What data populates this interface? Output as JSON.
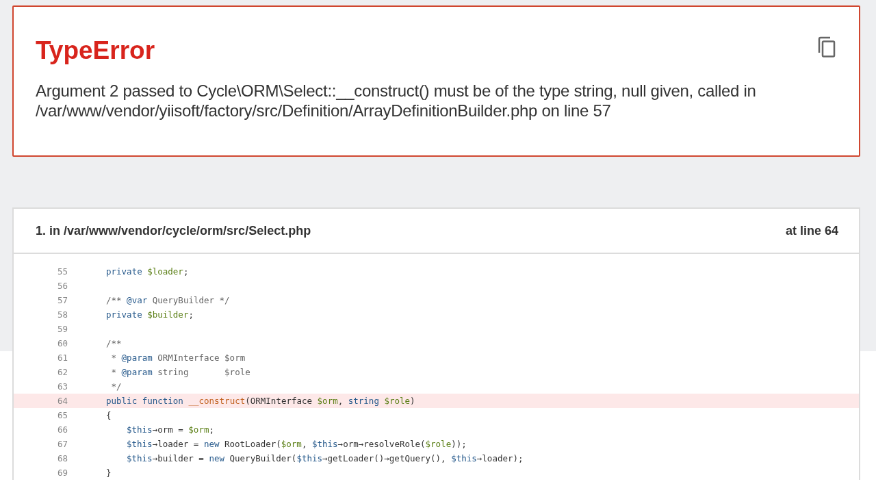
{
  "error": {
    "type": "TypeError",
    "message": "Argument 2 passed to Cycle\\ORM\\Select::__construct() must be of the type string, null given, called in /var/www/vendor/yiisoft/factory/src/Definition/ArrayDefinitionBuilder.php on line 57"
  },
  "frame": {
    "title": "1. in /var/www/vendor/cycle/orm/src/Select.php",
    "line_label": "at line 64",
    "lines": [
      {
        "number": "55",
        "selected": false,
        "tokens": [
          {
            "kind": "keyword",
            "text": "private "
          },
          {
            "kind": "variable",
            "text": "$loader"
          },
          {
            "kind": "plain",
            "text": ";"
          }
        ]
      },
      {
        "number": "56",
        "selected": false
      },
      {
        "number": "57",
        "selected": false,
        "tokens": [
          {
            "kind": "comment",
            "text": "/** "
          },
          {
            "kind": "tag",
            "text": "@var"
          },
          {
            "kind": "comment",
            "text": " QueryBuilder */"
          }
        ]
      },
      {
        "number": "58",
        "selected": false,
        "tokens": [
          {
            "kind": "keyword",
            "text": "private "
          },
          {
            "kind": "variable",
            "text": "$builder"
          },
          {
            "kind": "plain",
            "text": ";"
          }
        ]
      },
      {
        "number": "59",
        "selected": false
      },
      {
        "number": "60",
        "selected": false,
        "tokens": [
          {
            "kind": "comment",
            "text": "/**"
          }
        ]
      },
      {
        "number": "61",
        "selected": false,
        "tokens": [
          {
            "kind": "comment",
            "text": " * "
          },
          {
            "kind": "tag",
            "text": "@param"
          },
          {
            "kind": "comment",
            "text": " ORMInterface $orm"
          }
        ]
      },
      {
        "number": "62",
        "selected": false,
        "tokens": [
          {
            "kind": "comment",
            "text": " * "
          },
          {
            "kind": "tag",
            "text": "@param"
          },
          {
            "kind": "comment",
            "text": " string       $role"
          }
        ]
      },
      {
        "number": "63",
        "selected": false,
        "tokens": [
          {
            "kind": "comment",
            "text": " */"
          }
        ]
      },
      {
        "number": "64",
        "selected": true,
        "tokens": [
          {
            "kind": "keyword",
            "text": "public function "
          },
          {
            "kind": "function",
            "text": "__construct"
          },
          {
            "kind": "plain",
            "text": "(ORMInterface "
          },
          {
            "kind": "variable",
            "text": "$orm"
          },
          {
            "kind": "plain",
            "text": ", "
          },
          {
            "kind": "keyword",
            "text": "string "
          },
          {
            "kind": "variable",
            "text": "$role"
          },
          {
            "kind": "plain",
            "text": ")"
          }
        ]
      },
      {
        "number": "65",
        "selected": false,
        "tokens": [
          {
            "kind": "plain",
            "text": "{"
          }
        ],
        "children": [
          {
            "number": "66",
            "selected": false,
            "tokens": [
              {
                "kind": "this",
                "text": "$this"
              },
              {
                "kind": "plain",
                "text": "→orm = "
              },
              {
                "kind": "variable",
                "text": "$orm"
              },
              {
                "kind": "plain",
                "text": ";"
              }
            ]
          },
          {
            "number": "67",
            "selected": false,
            "tokens": [
              {
                "kind": "this",
                "text": "$this"
              },
              {
                "kind": "plain",
                "text": "→loader = "
              },
              {
                "kind": "keyword",
                "text": "new"
              },
              {
                "kind": "plain",
                "text": " RootLoader("
              },
              {
                "kind": "variable",
                "text": "$orm"
              },
              {
                "kind": "plain",
                "text": ", "
              },
              {
                "kind": "this",
                "text": "$this"
              },
              {
                "kind": "plain",
                "text": "→orm→resolveRole("
              },
              {
                "kind": "variable",
                "text": "$role"
              },
              {
                "kind": "plain",
                "text": "));"
              }
            ]
          },
          {
            "number": "68",
            "selected": false,
            "tokens": [
              {
                "kind": "this",
                "text": "$this"
              },
              {
                "kind": "plain",
                "text": "→builder = "
              },
              {
                "kind": "keyword",
                "text": "new"
              },
              {
                "kind": "plain",
                "text": " QueryBuilder("
              },
              {
                "kind": "this",
                "text": "$this"
              },
              {
                "kind": "plain",
                "text": "→getLoader()→getQuery(), "
              },
              {
                "kind": "this",
                "text": "$this"
              },
              {
                "kind": "plain",
                "text": "→loader);"
              }
            ]
          }
        ]
      },
      {
        "number": "69",
        "selected": false,
        "tokens": [
          {
            "kind": "plain",
            "text": "}"
          }
        ]
      }
    ]
  }
}
